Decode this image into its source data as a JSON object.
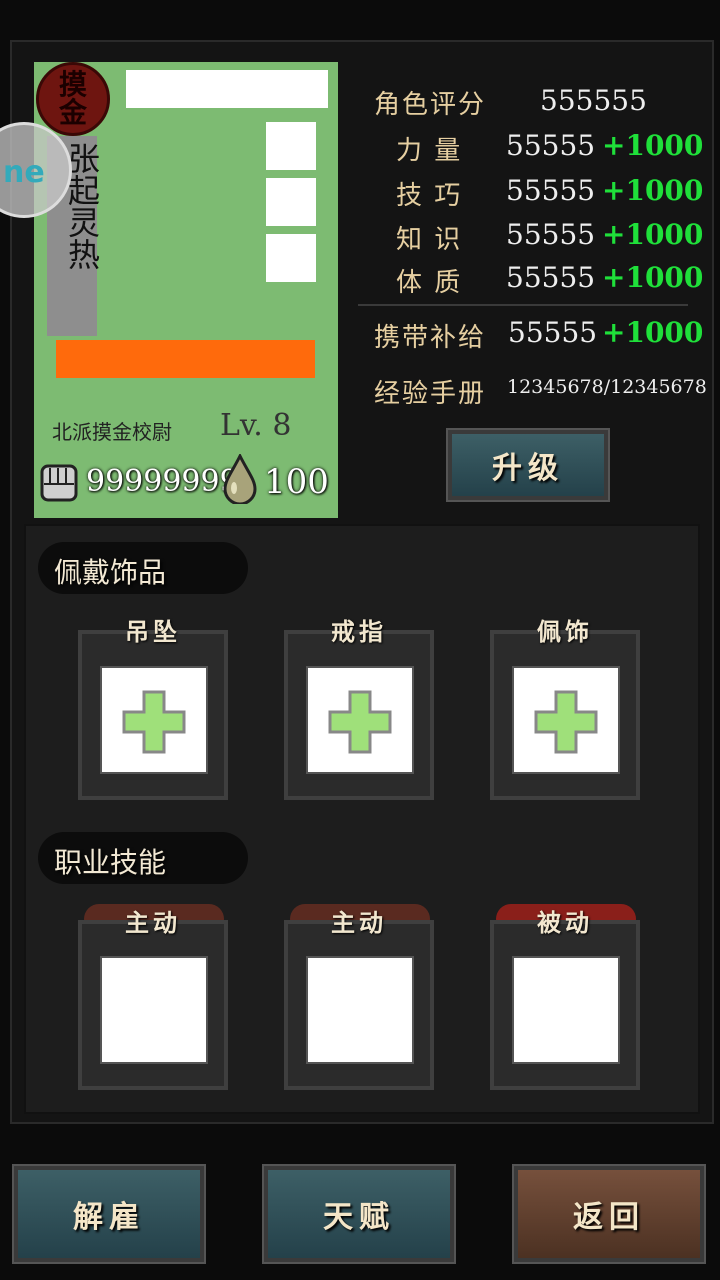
{
  "character": {
    "seal_text": "摸金",
    "name": "张起灵热",
    "title": "北派摸金校尉",
    "level_label": "Lv. 8",
    "money": "99999999",
    "supply": "100"
  },
  "stats": {
    "rating_label": "角色评分",
    "rating_value": "555555",
    "rows": [
      {
        "label": "力 量",
        "value": "55555",
        "bonus": "+1000"
      },
      {
        "label": "技 巧",
        "value": "55555",
        "bonus": "+1000"
      },
      {
        "label": "知 识",
        "value": "55555",
        "bonus": "+1000"
      },
      {
        "label": "体 质",
        "value": "55555",
        "bonus": "+1000"
      }
    ],
    "carry_label": "携带补给",
    "carry_value": "55555",
    "carry_bonus": "+1000",
    "exp_label": "经验手册",
    "exp_value": "12345678/12345678"
  },
  "upgrade_button": "升级",
  "accessories": {
    "title": "佩戴饰品",
    "slots": [
      "吊坠",
      "戒指",
      "佩饰"
    ]
  },
  "skills": {
    "title": "职业技能",
    "slots": [
      "主动",
      "主动",
      "被动"
    ]
  },
  "bottom_buttons": {
    "dismiss": "解雇",
    "talent": "天赋",
    "back": "返回"
  },
  "colors": {
    "card_bg": "#7dbb72",
    "bonus_green": "#1fe03a",
    "orange_bar": "#ff6a0c",
    "passive_tag": "#8a1f1a",
    "active_tag": "#5a2a20"
  },
  "side_widget_text": "ne"
}
